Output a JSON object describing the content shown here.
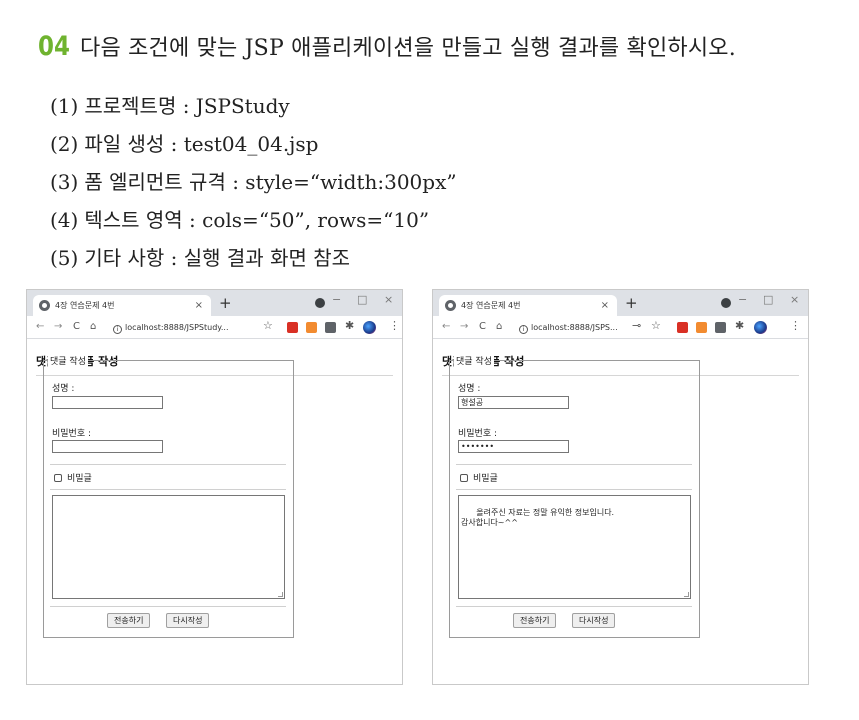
{
  "question": {
    "number": "04",
    "text": "다음 조건에 맞는 JSP 애플리케이션을 만들고 실행 결과를 확인하시오."
  },
  "requirements": [
    {
      "num": "(1)",
      "text": "프로젝트명 : JSPStudy"
    },
    {
      "num": "(2)",
      "text": "파일 생성 : test04_04.jsp"
    },
    {
      "num": "(3)",
      "text": "폼 엘리먼트 규격 : style=“width:300px”"
    },
    {
      "num": "(4)",
      "text": "텍스트 영역 : cols=“50”, rows=“10”"
    },
    {
      "num": "(5)",
      "text": "기타 사항 : 실행 결과 화면 참조"
    }
  ],
  "screens": [
    {
      "tab_title": "4장 연습문제 4번",
      "tab_close": "×",
      "new_tab": "+",
      "url": "localhost:8888/JSPStudy...",
      "page_title": "댓글 입력 폼 작성",
      "legend": "댓글 작성",
      "name_label": "성명 :",
      "name_value": "",
      "password_label": "비밀번호 :",
      "password_value": "",
      "secret_label": "비밀글",
      "comment_value": "",
      "submit_label": "전송하기",
      "reset_label": "다시작성"
    },
    {
      "tab_title": "4장 연습문제 4번",
      "tab_close": "×",
      "new_tab": "+",
      "url": "localhost:8888/JSPS...",
      "page_title": "댓글 입력 폼 작성",
      "legend": "댓글 작성",
      "name_label": "성명 :",
      "name_value": "형설공",
      "password_label": "비밀번호 :",
      "password_value": "•••••••",
      "secret_label": "비밀글",
      "comment_value": "올려주신 자료는 정말 유익한 정보입니다.\n감사합니다~^^",
      "submit_label": "전송하기",
      "reset_label": "다시작성"
    }
  ],
  "chrome": {
    "back": "←",
    "forward": "→",
    "reload": "C",
    "home": "⌂",
    "info": "i",
    "star": "☆",
    "more": "⋮",
    "key": "⊸",
    "puzzle": "✱",
    "minimize": "−",
    "maximize": "□",
    "close": "×"
  },
  "colors": {
    "accent_number": "#6fb32f",
    "tabbar": "#dee1e6",
    "ext_pdf": "#d93025",
    "ext_orange": "#f28b30",
    "ext_gray": "#5f6368"
  }
}
